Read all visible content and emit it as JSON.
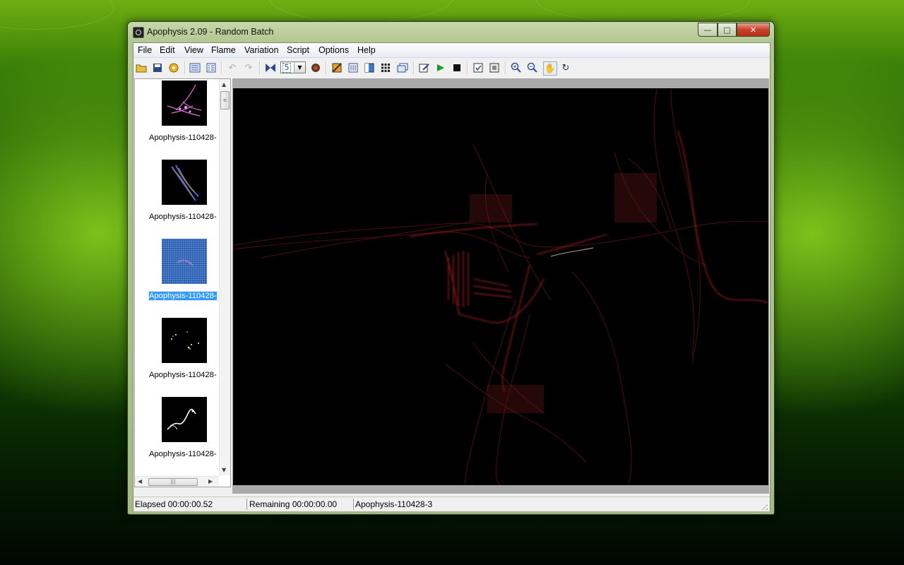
{
  "window": {
    "title": "Apophysis 2.09 - Random Batch",
    "controls": {
      "minimize": "—",
      "maximize": "□",
      "close": "✕"
    }
  },
  "menu": [
    "File",
    "Edit",
    "View",
    "Flame",
    "Variation",
    "Script",
    "Options",
    "Help"
  ],
  "toolbar": {
    "batch_size": "5",
    "icons": [
      "open-icon",
      "save-icon",
      "random-batch-icon",
      "list-large-icon",
      "list-small-icon",
      "undo-icon",
      "redo-icon",
      "mutate-icon",
      "batch-combo",
      "edit-gradient-icon",
      "adjust-icon",
      "editor-icon",
      "gradient-icon",
      "grid-icon",
      "copy-icon",
      "edit-script-icon",
      "run-script-icon",
      "stop-script-icon",
      "options-icon",
      "fullscreen-icon",
      "zoom-in-icon",
      "zoom-out-icon",
      "pan-hand-icon",
      "rotate-icon"
    ]
  },
  "thumbnails": [
    {
      "label": "Apophysis-110428-",
      "selected": false
    },
    {
      "label": "Apophysis-110428-",
      "selected": false
    },
    {
      "label": "Apophysis-110428-",
      "selected": true
    },
    {
      "label": "Apophysis-110428-",
      "selected": false
    },
    {
      "label": "Apophysis-110428-",
      "selected": false
    }
  ],
  "status": {
    "elapsed": "Elapsed 00:00:00.52",
    "remaining": "Remaining 00:00:00.00",
    "flame": "Apophysis-110428-3"
  },
  "colors": {
    "selection": "#3399ff",
    "fractal": "#c0282a",
    "canvas": "#000000"
  }
}
